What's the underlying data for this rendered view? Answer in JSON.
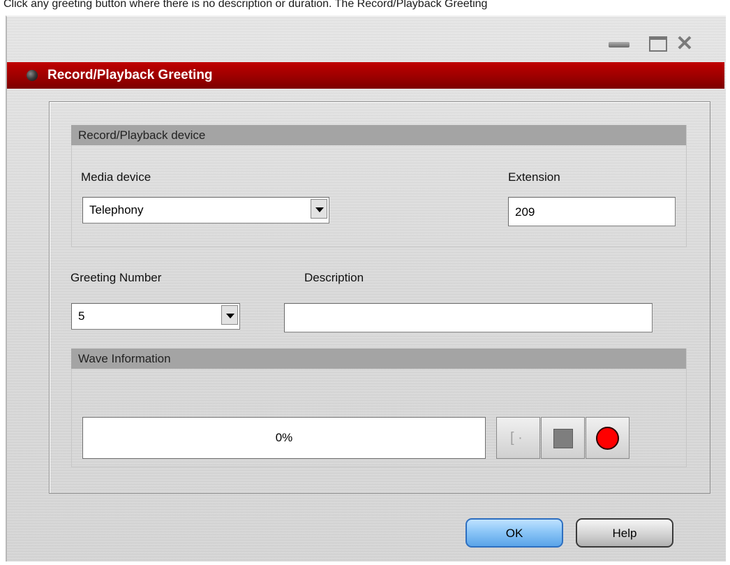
{
  "caption": "Click any greeting button where there is no description or duration. The Record/Playback Greeting",
  "window": {
    "title": "Record/Playback Greeting",
    "controls": {
      "minimize": "minimize-icon",
      "maximize": "maximize-icon",
      "close": "close-icon"
    }
  },
  "device_section": {
    "header": "Record/Playback device",
    "media_device_label": "Media device",
    "media_device_value": "Telephony",
    "extension_label": "Extension",
    "extension_value": "209"
  },
  "greeting": {
    "number_label": "Greeting Number",
    "number_value": "5",
    "description_label": "Description",
    "description_value": ""
  },
  "wave_section": {
    "header": "Wave Information",
    "progress_text": "0%",
    "progress_value": 0,
    "buttons": [
      "play-icon",
      "stop-icon",
      "record-icon"
    ]
  },
  "buttons": {
    "ok": "OK",
    "help": "Help"
  },
  "colors": {
    "title_bar": "#a00000",
    "record": "#ff0000",
    "ok_button": "#8cc6f7"
  }
}
